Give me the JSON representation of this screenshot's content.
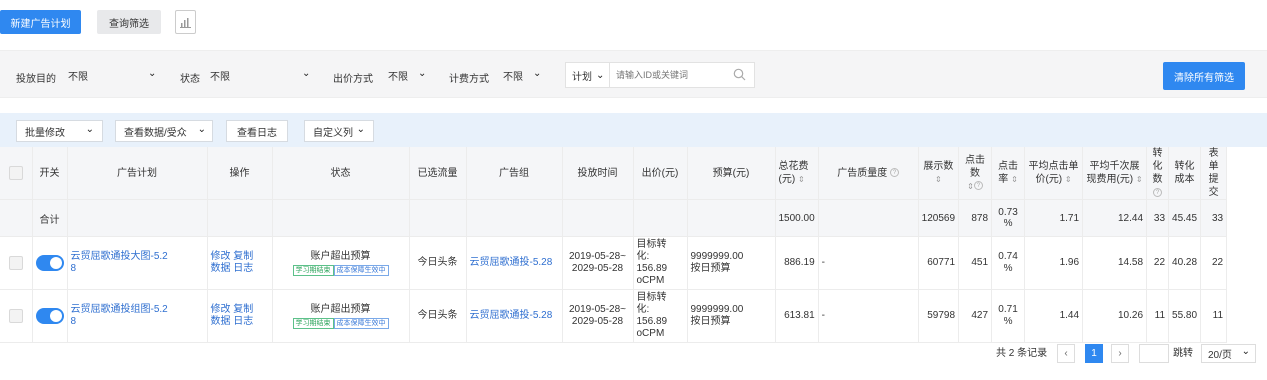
{
  "top": {
    "new_plan": "新建广告计划",
    "query_filter": "查询筛选",
    "chart_icon": "bar-chart-icon"
  },
  "filters": {
    "purpose_label": "投放目的",
    "purpose_value": "不限",
    "status_label": "状态",
    "status_value": "不限",
    "bid_label": "出价方式",
    "bid_value": "不限",
    "billing_label": "计费方式",
    "billing_value": "不限",
    "scope_value": "计划",
    "search_placeholder": "请输入ID或关键词",
    "clear_all": "清除所有筛选"
  },
  "toolbar": {
    "batch_edit": "批量修改",
    "view_data": "查看数据/受众",
    "view_log": "查看日志",
    "custom_cols": "自定义列"
  },
  "columns": {
    "switch": "开关",
    "plan": "广告计划",
    "ops": "操作",
    "status": "状态",
    "traffic": "已选流量",
    "group": "广告组",
    "time": "投放时间",
    "bid": "出价(元)",
    "budget": "预算(元)",
    "cost": "总花费(元)",
    "quality": "广告质量度",
    "impressions": "展示数",
    "clicks": "点击数",
    "ctr": "点击率",
    "cpc": "平均点击单价(元)",
    "cpm": "平均千次展现费用(元)",
    "conv": "转化数",
    "conv_cost": "转化成本",
    "forms": "表单提交"
  },
  "total": {
    "label": "合计",
    "cost": "1500.00",
    "impressions": "120569",
    "clicks": "878",
    "ctr": "0.73 %",
    "cpc": "1.71",
    "cpm": "12.44",
    "conv": "33",
    "conv_cost": "45.45",
    "forms": "33"
  },
  "rows": [
    {
      "plan_l1": "云贸屈歌通投大图-5.2",
      "plan_l2": "8",
      "op1": "修改 复制",
      "op2": "数据 日志",
      "status": "账户超出预算",
      "tag1": "学习期结束",
      "tag2": "成本保障生效中",
      "traffic": "今日头条",
      "group": "云贸屈歌通投-5.28",
      "time1": "2019-05-28~",
      "time2": "2029-05-28",
      "bid1": "目标转",
      "bid2": "化:",
      "bid3": "156.89",
      "bid4": "oCPM",
      "budget1": "9999999.00",
      "budget2": "按日预算",
      "cost": "886.19",
      "quality": "-",
      "impressions": "60771",
      "clicks": "451",
      "ctr": "0.74 %",
      "cpc": "1.96",
      "cpm": "14.58",
      "conv": "22",
      "conv_cost": "40.28",
      "forms": "22"
    },
    {
      "plan_l1": "云贸屈歌通投组图-5.2",
      "plan_l2": "8",
      "op1": "修改 复制",
      "op2": "数据 日志",
      "status": "账户超出预算",
      "tag1": "学习期结束",
      "tag2": "成本保障生效中",
      "traffic": "今日头条",
      "group": "云贸屈歌通投-5.28",
      "time1": "2019-05-28~",
      "time2": "2029-05-28",
      "bid1": "目标转",
      "bid2": "化:",
      "bid3": "156.89",
      "bid4": "oCPM",
      "budget1": "9999999.00",
      "budget2": "按日预算",
      "cost": "613.81",
      "quality": "-",
      "impressions": "59798",
      "clicks": "427",
      "ctr": "0.71 %",
      "cpc": "1.44",
      "cpm": "10.26",
      "conv": "11",
      "conv_cost": "55.80",
      "forms": "11"
    }
  ],
  "pager": {
    "total": "共 2 条记录",
    "prev": "‹",
    "page": "1",
    "next": "›",
    "jump": "跳转",
    "per_page": "20/页"
  }
}
